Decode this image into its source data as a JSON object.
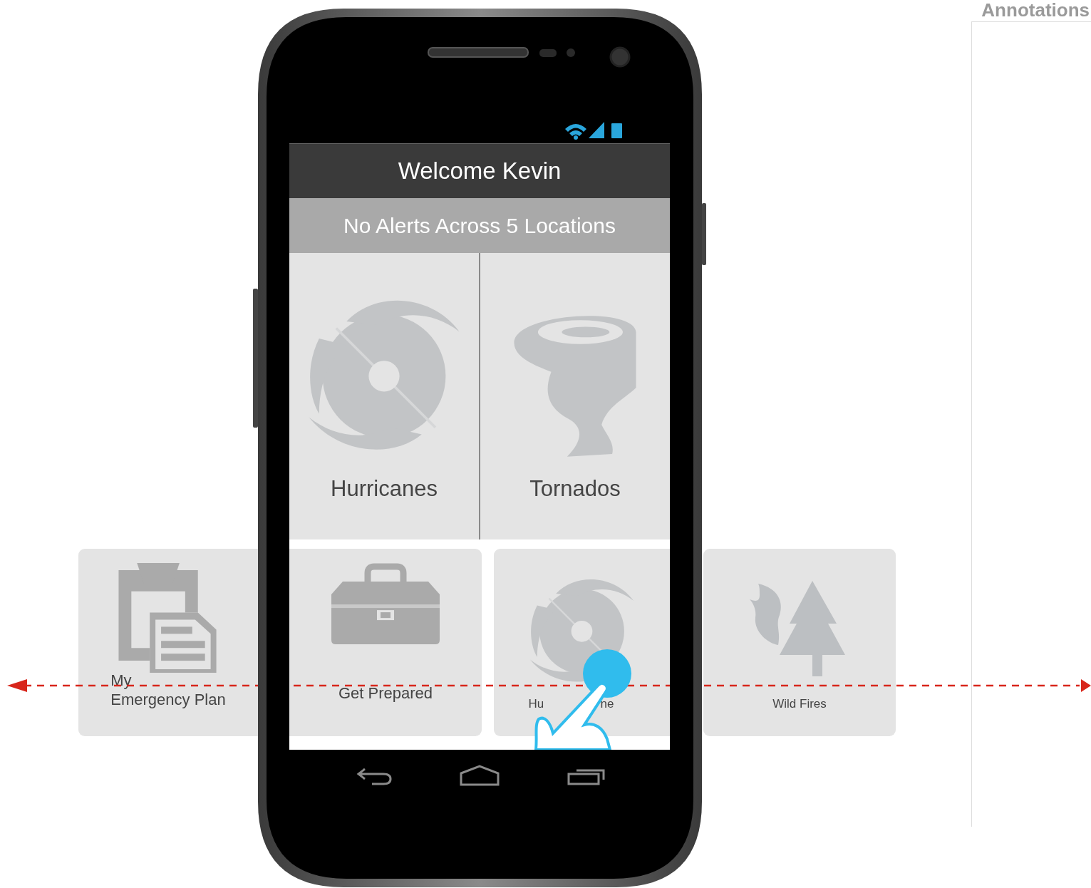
{
  "annotations": {
    "title": "Annotations"
  },
  "app": {
    "header": {
      "title": "Welcome Kevin"
    },
    "alert_bar": {
      "text": "No Alerts Across 5 Locations"
    },
    "tiles": [
      {
        "kind": "hurricane",
        "label": "Hurricanes"
      },
      {
        "kind": "tornado",
        "label": "Tornados"
      }
    ],
    "carousel": [
      {
        "kind": "plan",
        "label": "My\nEmergency Plan"
      },
      {
        "kind": "toolbox",
        "label": "Get Prepared"
      },
      {
        "kind": "hurricane",
        "label_parts": [
          "Hu",
          "ne"
        ]
      },
      {
        "kind": "wildfire",
        "label": "Wild Fires"
      }
    ]
  }
}
